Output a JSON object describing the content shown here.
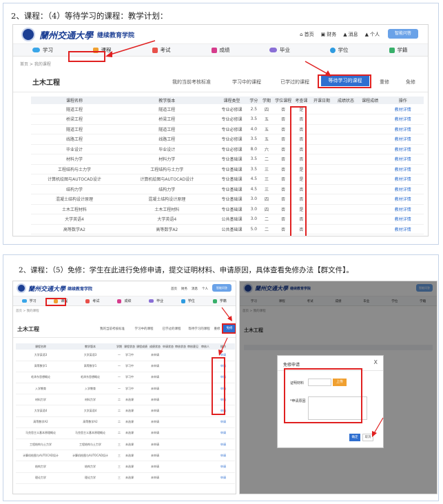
{
  "section1": {
    "heading": "2、课程：（4）等待学习的课程：教学计划："
  },
  "section2": {
    "heading": "2、课程：（5）免修：学生在此进行免修申请，提交证明材料、申请原因，具体查看免修办法【群文件】。"
  },
  "site": {
    "logo_cn": "蘭州交通大學",
    "logo_sub": "继续教育学院",
    "top_links": [
      "首页",
      "财务",
      "消息",
      "个人"
    ],
    "badge": "智能问答",
    "nav": [
      {
        "label": "学习",
        "color": "#3aa6e8"
      },
      {
        "label": "课程",
        "color": "#f0a030"
      },
      {
        "label": "考试",
        "color": "#e8504a"
      },
      {
        "label": "成绩",
        "color": "#d63c8c"
      },
      {
        "label": "毕业",
        "color": "#8a6fd6"
      },
      {
        "label": "学位",
        "color": "#2e9be0"
      },
      {
        "label": "学籍",
        "color": "#38b06a"
      }
    ],
    "breadcrumb": "首页 > 我的课程",
    "major": "土木工程",
    "tabs": [
      "我的当前考核标准",
      "学习中的课程",
      "已学过的课程",
      "等待学习的课程",
      "重修",
      "免修"
    ]
  },
  "plan_table": {
    "headers": [
      "课程名称",
      "教学版本",
      "课程类型",
      "学分",
      "学期",
      "学位课程",
      "考查课",
      "开课日期",
      "成绩状态",
      "课程成绩",
      "操作"
    ],
    "rows": [
      [
        "隧道工程",
        "隧道工程",
        "专业必修课",
        "2.5",
        "四",
        "否",
        "是",
        "",
        "",
        "",
        "教材详情"
      ],
      [
        "桥梁工程",
        "桥梁工程",
        "专业必修课",
        "3.5",
        "五",
        "否",
        "否",
        "",
        "",
        "",
        "教材详情"
      ],
      [
        "隧道工程",
        "隧道工程",
        "专业必修课",
        "4.0",
        "五",
        "否",
        "否",
        "",
        "",
        "",
        "教材详情"
      ],
      [
        "线路工程",
        "线路工程",
        "专业必修课",
        "3.5",
        "五",
        "否",
        "否",
        "",
        "",
        "",
        "教材详情"
      ],
      [
        "毕业设计",
        "毕业设计",
        "专业必修课",
        "8.0",
        "六",
        "否",
        "否",
        "",
        "",
        "",
        "教材详情"
      ],
      [
        "材料力学",
        "材料力学",
        "专业基础课",
        "3.5",
        "二",
        "否",
        "否",
        "",
        "",
        "",
        "教材详情"
      ],
      [
        "工程结构与土力学",
        "工程结构与土力学",
        "专业基础课",
        "3.5",
        "三",
        "否",
        "是",
        "",
        "",
        "",
        "教材详情"
      ],
      [
        "计算机绘图与AUTOCAD设计",
        "计算机绘图与AUTOCAD设计",
        "专业基础课",
        "4.5",
        "三",
        "否",
        "是",
        "",
        "",
        "",
        "教材详情"
      ],
      [
        "结构力学",
        "结构力学",
        "专业基础课",
        "4.5",
        "三",
        "否",
        "否",
        "",
        "",
        "",
        "教材详情"
      ],
      [
        "混凝土结构设计原理",
        "混凝土结构设计原理",
        "专业基础课",
        "3.0",
        "四",
        "否",
        "否",
        "",
        "",
        "",
        "教材详情"
      ],
      [
        "土木工程材料",
        "土木工程材料",
        "专业基础课",
        "3.0",
        "四",
        "否",
        "是",
        "",
        "",
        "",
        "教材详情"
      ],
      [
        "大学英语4",
        "大学英语4",
        "公共基础课",
        "3.0",
        "二",
        "否",
        "否",
        "",
        "",
        "",
        "教材详情"
      ],
      [
        "高等数学A2",
        "高等数学A2",
        "公共基础课",
        "5.0",
        "二",
        "否",
        "否",
        "",
        "",
        "",
        "教材详情"
      ]
    ]
  },
  "exempt_table": {
    "headers": [
      "课程名称",
      "教学版本",
      "学期",
      "课程状态",
      "课程成绩",
      "成绩状态",
      "申请状态",
      "审核状态",
      "审核意见",
      "审核人",
      "操作"
    ],
    "rows": [
      [
        "大学英语3",
        "大学英语3",
        "一",
        "学习中",
        "",
        "未申请",
        "",
        "",
        "",
        "",
        "申请"
      ],
      [
        "高等数学1",
        "高等数学1",
        "一",
        "学习中",
        "",
        "未申请",
        "",
        "",
        "",
        "",
        "申请"
      ],
      [
        "毛泽东思想概论",
        "毛泽东思想概论",
        "一",
        "学习中",
        "",
        "未申请",
        "",
        "",
        "",
        "",
        "申请"
      ],
      [
        "入学教育",
        "入学教育",
        "一",
        "学习中",
        "",
        "未申请",
        "",
        "",
        "",
        "",
        "申请"
      ],
      [
        "材料力学",
        "材料力学",
        "二",
        "未选课",
        "",
        "未申请",
        "",
        "",
        "",
        "",
        "申请"
      ],
      [
        "大学英语4",
        "大学英语4",
        "二",
        "未选课",
        "",
        "未申请",
        "",
        "",
        "",
        "",
        "申请"
      ],
      [
        "高等数学A2",
        "高等数学A2",
        "二",
        "未选课",
        "",
        "未申请",
        "",
        "",
        "",
        "",
        "申请"
      ],
      [
        "马克思主义基本原理概论",
        "马克思主义基本原理概论",
        "二",
        "未选课",
        "",
        "未申请",
        "",
        "",
        "",
        "",
        "申请"
      ],
      [
        "工程结构与土力学",
        "工程结构与土力学",
        "三",
        "未选课",
        "",
        "未申请",
        "",
        "",
        "",
        "",
        "申请"
      ],
      [
        "计算机绘图与AUTOCAD设计",
        "计算机绘图与AUTOCAD设计",
        "三",
        "未选课",
        "",
        "未申请",
        "",
        "",
        "",
        "",
        "申请"
      ],
      [
        "结构力学",
        "结构力学",
        "三",
        "未选课",
        "",
        "未申请",
        "",
        "",
        "",
        "",
        "申请"
      ],
      [
        "理论力学",
        "理论力学",
        "三",
        "未选课",
        "",
        "未申请",
        "",
        "",
        "",
        "",
        "申请"
      ]
    ]
  },
  "modal": {
    "title": "免修申请",
    "close": "X",
    "proof_label": "证明材料",
    "upload_button": "上传",
    "reason_label": "*申请原因",
    "confirm": "确定",
    "cancel": "取消"
  },
  "colors": {
    "accent": "#2f6fd0",
    "annotation": "#e02020"
  }
}
